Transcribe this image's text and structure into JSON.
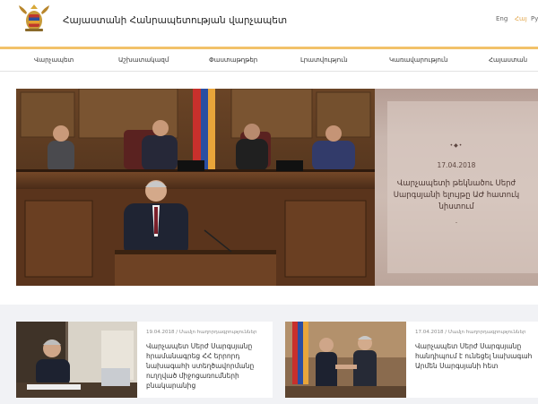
{
  "header": {
    "title": "Հայաստանի Հանրապետության վարչապետ",
    "languages": [
      "Eng",
      "Հայ",
      "Рус"
    ],
    "active_language": "Հայ"
  },
  "nav": {
    "items": [
      "Վարչապետ",
      "Աշխատակազմ",
      "Փաստաթղթեր",
      "Լրատվություն",
      "Կառավարություն",
      "Հայաստան"
    ]
  },
  "hero": {
    "dots": "•◆•",
    "date": "17.04.2018",
    "title": "Վարչապետի թեկնածու Սերժ Սարգսյանի ելույթը ԱԺ հատուկ նիստում",
    "dash": "-"
  },
  "news": [
    {
      "meta": "19.04.2018 / Մամլո հաղորդագրություններ",
      "title": "Վարչապետ Սերժ Սարգսյանը հրամանագրեց ՀՀ երրորդ նախագահի ստեղծավորմանը ուղղված միջոցառումների բնակարանից"
    },
    {
      "meta": "17.04.2018 / Մամլո հաղորդագրություններ",
      "title": "Վարչապետ Սերժ Սարգսյանը հանդիպում է ունեցել նախագահ Արմեն Սարգսյանի հետ"
    }
  ],
  "colors": {
    "accent": "#f2c26a",
    "active_language": "#e2a64a"
  }
}
